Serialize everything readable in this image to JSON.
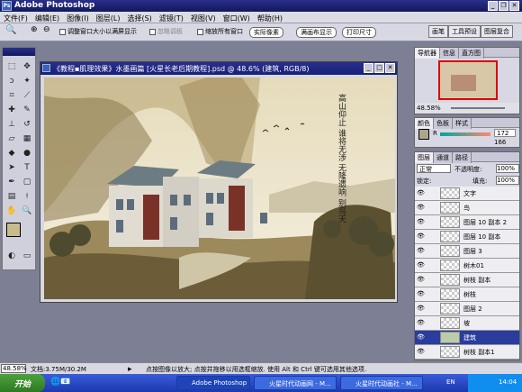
{
  "window": {
    "title": "Adobe Photoshop",
    "app_icon": "Ps"
  },
  "menu": [
    "文件(F)",
    "编辑(E)",
    "图像(I)",
    "图层(L)",
    "选择(S)",
    "滤镜(T)",
    "视图(V)",
    "窗口(W)",
    "帮助(H)"
  ],
  "options": {
    "resize_window": "调整窗口大小以满屏显示",
    "ignore_palettes": "忽略调板",
    "zoom_all": "缩放所有窗口",
    "actual_pixels": "实际像素",
    "fit_screen": "满画布显示",
    "print_size": "打印尺寸"
  },
  "palette_tabs": [
    "画笔",
    "工具预设",
    "图层复合"
  ],
  "document": {
    "title": "《教程▪肌理效果》水墨画篇 [火星长老后期教程].psd @ 48.6% (建筑, RGB/8)"
  },
  "calligraphy": "高山仰止 谁将无涉 无隆遗响 别鸟天",
  "navigator": {
    "tabs": [
      "导航器",
      "信息",
      "直方图"
    ],
    "zoom": "48.58%"
  },
  "color_panel": {
    "tabs": [
      "颜色",
      "色板",
      "样式"
    ],
    "r": "172",
    "g": "166"
  },
  "layers_panel": {
    "tabs": [
      "图层",
      "通道",
      "路径"
    ],
    "blend_mode": "正常",
    "opacity_label": "不透明度:",
    "opacity": "100%",
    "lock_label": "锁定:",
    "fill_label": "填充:",
    "fill": "100%",
    "layers": [
      "文字",
      "鸟",
      "图层 10 副本 2",
      "图层 10 副本",
      "图层 3",
      "树木01",
      "树枝 副本",
      "树枝",
      "图层 2",
      "坡",
      "建筑",
      "树枝 副本1"
    ],
    "selected": "建筑"
  },
  "status": {
    "zoom": "48.58%",
    "doc_size": "文档:3.75M/30.2M",
    "hint": "点按图像以放大; 点按并拖移以用选框缩放. 使用 Alt 和 Ctrl 键可选用其他选项."
  },
  "taskbar": {
    "start": "开始",
    "tasks": [
      "Adobe Photoshop",
      "火星时代动画网 - M...",
      "火星时代动画社 - M..."
    ],
    "lang": "EN",
    "clock": "14:04"
  }
}
